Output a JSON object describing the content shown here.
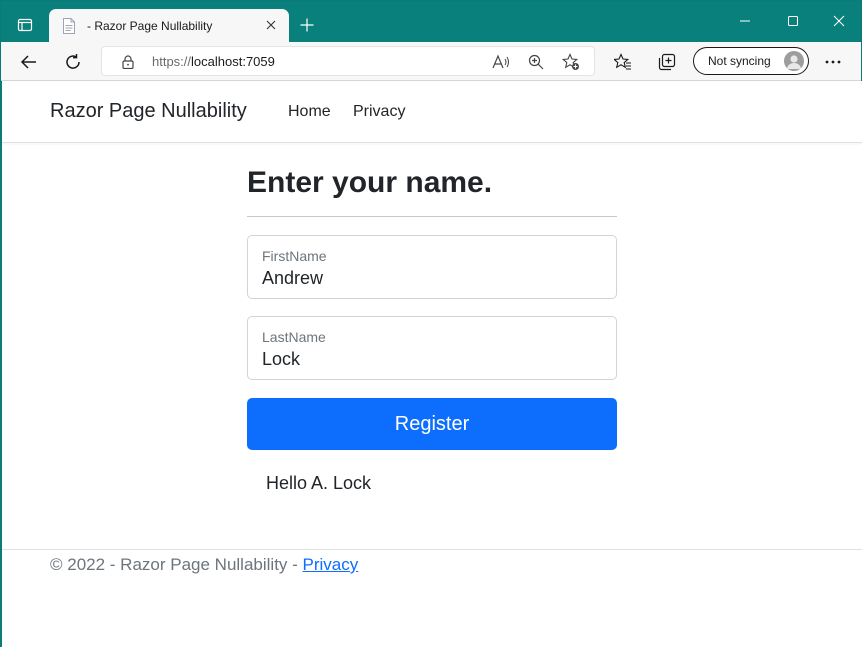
{
  "browser": {
    "tab_title": "- Razor Page Nullability",
    "url_scheme": "https://",
    "url_host": "localhost:7059",
    "sync_label": "Not syncing"
  },
  "nav": {
    "brand": "Razor Page Nullability",
    "links": [
      "Home",
      "Privacy"
    ]
  },
  "form": {
    "heading": "Enter your name.",
    "first_name_label": "FirstName",
    "first_name_value": "Andrew",
    "last_name_label": "LastName",
    "last_name_value": "Lock",
    "submit_label": "Register"
  },
  "result": {
    "greeting": "Hello A. Lock"
  },
  "footer": {
    "text": "© 2022 - Razor Page Nullability - ",
    "link": "Privacy"
  },
  "colors": {
    "titlebar": "#0a807c",
    "primary": "#0d6efd"
  }
}
